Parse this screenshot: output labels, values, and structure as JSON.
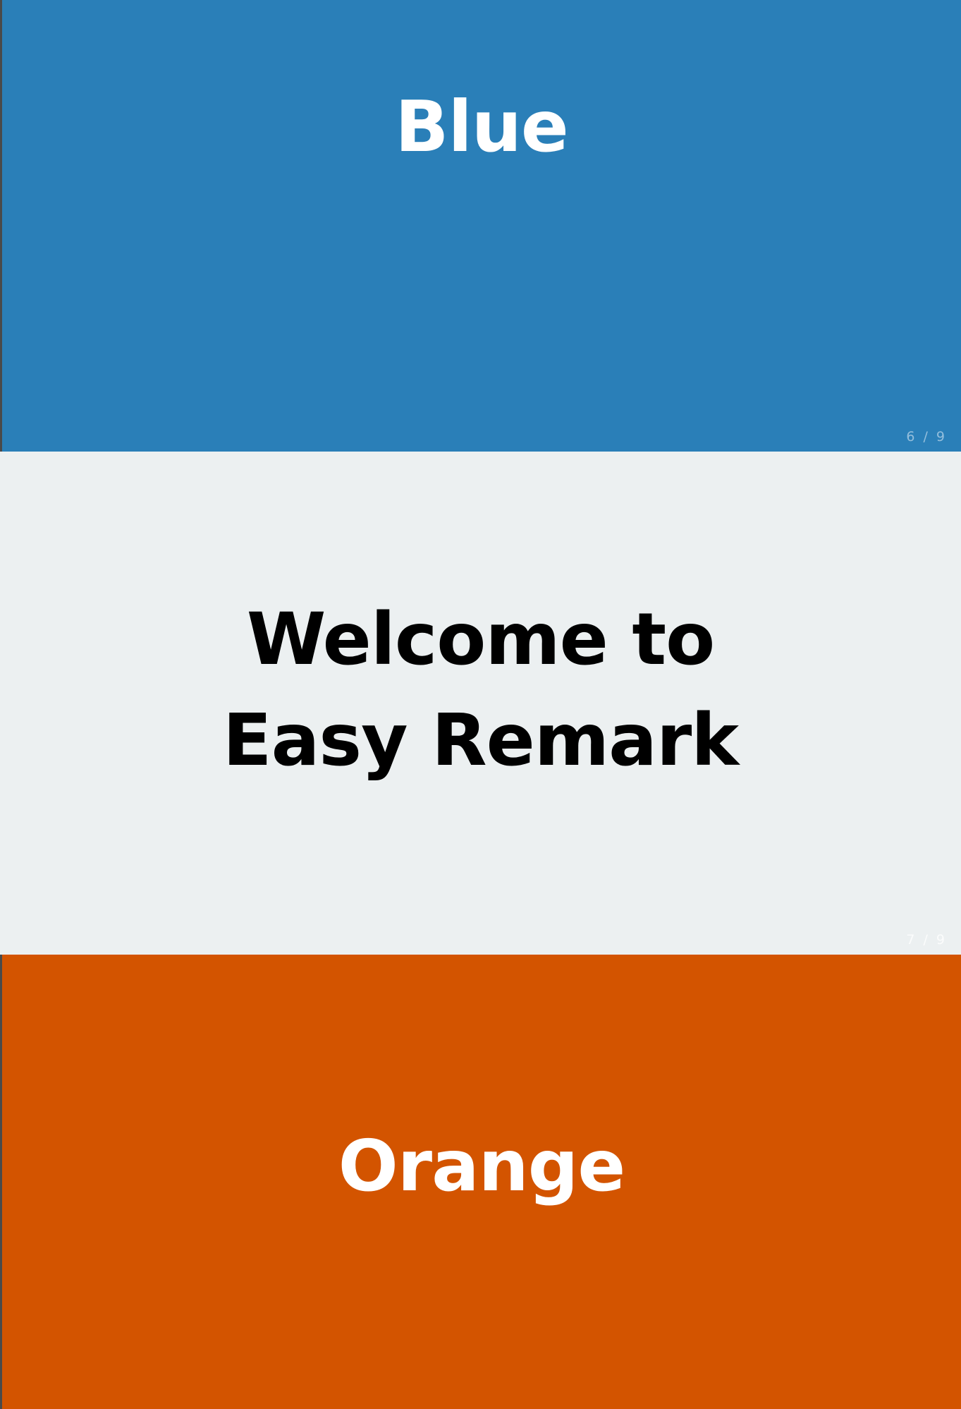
{
  "slides": [
    {
      "title": "Blue",
      "number": "6 / 9",
      "background": "#2a7fb8",
      "text_color": "#ffffff"
    },
    {
      "title": "Welcome to Easy Remark",
      "number": "7 / 9",
      "background": "#ecf0f1",
      "text_color": "#000000"
    },
    {
      "title": "Orange",
      "number": "",
      "background": "#d35400",
      "text_color": "#ffffff"
    }
  ]
}
